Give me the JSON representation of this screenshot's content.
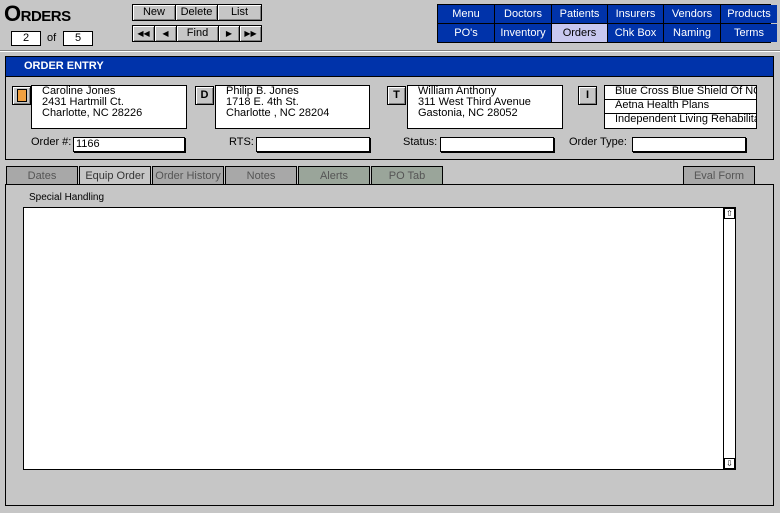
{
  "app": {
    "title": "Orders"
  },
  "record_nav": {
    "current": "2",
    "of_label": "of",
    "total": "5"
  },
  "toolbar": {
    "new": "New",
    "delete": "Delete",
    "list": "List",
    "first": "◀◀",
    "prev": "◀",
    "find": "Find",
    "next": "▶",
    "last": "▶▶"
  },
  "nav": {
    "row1": [
      "Menu",
      "Doctors",
      "Patients",
      "Insurers",
      "Vendors",
      "Products"
    ],
    "row2": [
      "PO's",
      "Inventory",
      "Orders",
      "Chk Box",
      "Naming",
      "Terms"
    ],
    "active": "Orders"
  },
  "order_entry": {
    "header": "ORDER ENTRY",
    "patient": {
      "line1": "Caroline Jones",
      "line2": "2431 Hartmill Ct.",
      "line3": "Charlotte, NC 28226"
    },
    "doctor": {
      "tag": "D",
      "line1": "Philip B. Jones",
      "line2": "1718 E. 4th St.",
      "line3": "Charlotte , NC 28204"
    },
    "therapist": {
      "tag": "T",
      "line1": "William Anthony",
      "line2": "311 West Third Avenue",
      "line3": "Gastonia, NC 28052"
    },
    "insurance": {
      "tag": "I",
      "items": [
        "Blue Cross Blue Shield Of NC",
        "Aetna Health Plans",
        "Independent Living Rehabilitation Program"
      ]
    },
    "fields": {
      "order_label": "Order #:",
      "order_value": "1166",
      "rts_label": "RTS:",
      "rts_value": "",
      "status_label": "Status:",
      "status_value": "",
      "order_type_label": "Order Type:",
      "order_type_value": ""
    }
  },
  "tabs": [
    "Dates",
    "Equip Order",
    "Order History",
    "Notes",
    "Alerts",
    "PO Tab",
    "Eval Form"
  ],
  "active_tab": "Equip Order",
  "content": {
    "section_label": "Special Handling",
    "text": "",
    "scroll_up": "⇧",
    "scroll_down": "⇩"
  }
}
